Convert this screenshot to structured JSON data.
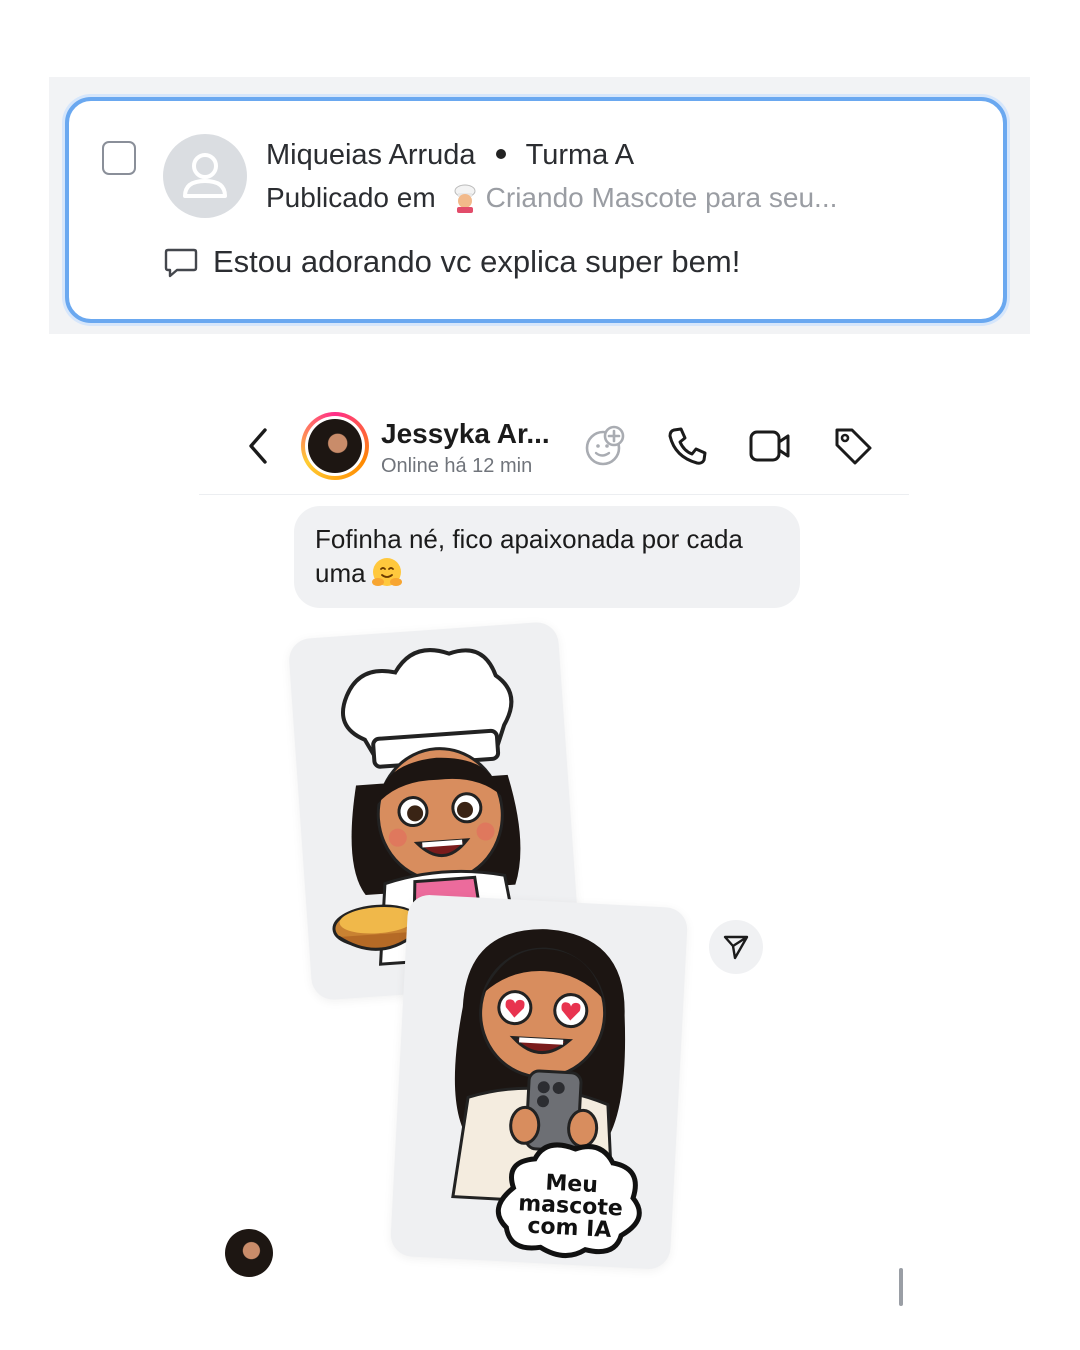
{
  "comment_card": {
    "author_name": "Miqueias Arruda",
    "class_name": "Turma A",
    "published_prefix": "Publicado em",
    "post_title": "Criando Mascote para seu...",
    "comment_text": "Estou adorando vc explica super bem!"
  },
  "chat": {
    "contact_name": "Jessyka Ar...",
    "contact_status": "Online há 12 min",
    "message_text": "Fofinha né, fico apaixonada por cada uma",
    "sticker_caption": [
      "Meu",
      "mascote",
      "com IA"
    ]
  },
  "colors": {
    "card_border": "#6aa8f0",
    "bubble_bg": "#f0f1f3",
    "story_ring": "#ff2d8a"
  },
  "icons": [
    "user-icon",
    "chef-emoji",
    "comment-bubble-icon",
    "back-arrow-icon",
    "sticker-add-icon",
    "phone-icon",
    "video-icon",
    "tag-icon",
    "hug-emoji",
    "send-icon"
  ]
}
